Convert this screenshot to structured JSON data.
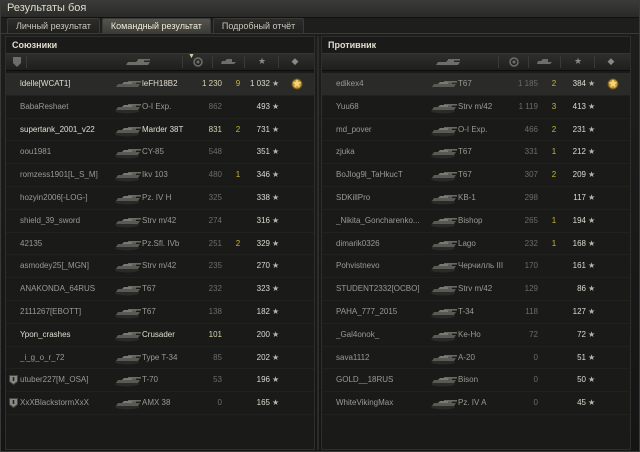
{
  "window": {
    "title": "Результаты боя"
  },
  "tabs": [
    {
      "label": "Личный результат",
      "active": false
    },
    {
      "label": "Командный результат",
      "active": true
    },
    {
      "label": "Подробный отчёт",
      "active": false
    }
  ],
  "allies": {
    "title": "Союзники",
    "rows": [
      {
        "name": "ldelle[WCAT1]",
        "vehicle": "leFH18B2",
        "damage": "1 230",
        "kills": "9",
        "xp": "1 032",
        "highlight": true,
        "medal": true,
        "platoon": false,
        "bright": true
      },
      {
        "name": "BabaReshaet",
        "vehicle": "O-I Exp.",
        "damage": "862",
        "kills": "",
        "xp": "493",
        "highlight": false,
        "medal": false,
        "platoon": false,
        "bright": false
      },
      {
        "name": "supertank_2001_v22",
        "vehicle": "Marder 38T",
        "damage": "831",
        "kills": "2",
        "xp": "731",
        "highlight": false,
        "medal": false,
        "platoon": false,
        "bright": true
      },
      {
        "name": "oou1981",
        "vehicle": "CY-85",
        "damage": "548",
        "kills": "",
        "xp": "351",
        "highlight": false,
        "medal": false,
        "platoon": false,
        "bright": false
      },
      {
        "name": "romzess1901[L_S_M]",
        "vehicle": "Ikv 103",
        "damage": "480",
        "kills": "1",
        "xp": "346",
        "highlight": false,
        "medal": false,
        "platoon": false,
        "bright": false
      },
      {
        "name": "hozyin2006[-LOG-]",
        "vehicle": "Pz. IV H",
        "damage": "325",
        "kills": "",
        "xp": "338",
        "highlight": false,
        "medal": false,
        "platoon": false,
        "bright": false
      },
      {
        "name": "shield_39_sword",
        "vehicle": "Strv m/42",
        "damage": "274",
        "kills": "",
        "xp": "316",
        "highlight": false,
        "medal": false,
        "platoon": false,
        "bright": false
      },
      {
        "name": "42135",
        "vehicle": "Pz.Sfl. IVb",
        "damage": "251",
        "kills": "2",
        "xp": "329",
        "highlight": false,
        "medal": false,
        "platoon": false,
        "bright": false
      },
      {
        "name": "asmodey25[_MGN]",
        "vehicle": "Strv m/42",
        "damage": "235",
        "kills": "",
        "xp": "270",
        "highlight": false,
        "medal": false,
        "platoon": false,
        "bright": false
      },
      {
        "name": "ANAKONDA_64RUS",
        "vehicle": "T67",
        "damage": "232",
        "kills": "",
        "xp": "323",
        "highlight": false,
        "medal": false,
        "platoon": false,
        "bright": false
      },
      {
        "name": "2111267[EBOTT]",
        "vehicle": "T67",
        "damage": "138",
        "kills": "",
        "xp": "182",
        "highlight": false,
        "medal": false,
        "platoon": false,
        "bright": false
      },
      {
        "name": "Ypon_crashes",
        "vehicle": "Crusader",
        "damage": "101",
        "kills": "",
        "xp": "200",
        "highlight": false,
        "medal": false,
        "platoon": false,
        "bright": true,
        "yellow": true
      },
      {
        "name": "_i_g_o_r_72",
        "vehicle": "Type T-34",
        "damage": "85",
        "kills": "",
        "xp": "202",
        "highlight": false,
        "medal": false,
        "platoon": false,
        "bright": false
      },
      {
        "name": "utuber227[M_OSA]",
        "vehicle": "T-70",
        "damage": "53",
        "kills": "",
        "xp": "196",
        "highlight": false,
        "medal": false,
        "platoon": true,
        "bright": false
      },
      {
        "name": "XxXBlackstormXxX",
        "vehicle": "AMX 38",
        "damage": "0",
        "kills": "",
        "xp": "165",
        "highlight": false,
        "medal": false,
        "platoon": true,
        "bright": false
      }
    ]
  },
  "enemies": {
    "title": "Противник",
    "rows": [
      {
        "name": "edikex4",
        "vehicle": "T67",
        "damage": "1 185",
        "kills": "2",
        "xp": "384",
        "highlight": true,
        "medal": true
      },
      {
        "name": "Yuu68",
        "vehicle": "Strv m/42",
        "damage": "1 119",
        "kills": "3",
        "xp": "413"
      },
      {
        "name": "md_pover",
        "vehicle": "O-I Exp.",
        "damage": "466",
        "kills": "2",
        "xp": "231"
      },
      {
        "name": "zjuka",
        "vehicle": "T67",
        "damage": "331",
        "kills": "1",
        "xp": "212"
      },
      {
        "name": "BoJlog9l_TaHkucT",
        "vehicle": "T67",
        "damage": "307",
        "kills": "2",
        "xp": "209"
      },
      {
        "name": "SDKillPro",
        "vehicle": "KB-1",
        "damage": "298",
        "kills": "",
        "xp": "117"
      },
      {
        "name": "_Nikita_Goncharenko...",
        "vehicle": "Bishop",
        "damage": "265",
        "kills": "1",
        "xp": "194"
      },
      {
        "name": "dimarik0326",
        "vehicle": "Lago",
        "damage": "232",
        "kills": "1",
        "xp": "168"
      },
      {
        "name": "Pohvistnevo",
        "vehicle": "Черчилль III",
        "damage": "170",
        "kills": "",
        "xp": "161"
      },
      {
        "name": "STUDENT2332[OCBO]",
        "vehicle": "Strv m/42",
        "damage": "129",
        "kills": "",
        "xp": "86"
      },
      {
        "name": "PAHA_777_2015",
        "vehicle": "T-34",
        "damage": "118",
        "kills": "",
        "xp": "127"
      },
      {
        "name": "_Gal4onok_",
        "vehicle": "Ke-Ho",
        "damage": "72",
        "kills": "",
        "xp": "72"
      },
      {
        "name": "sava1112",
        "vehicle": "A-20",
        "damage": "0",
        "kills": "",
        "xp": "51"
      },
      {
        "name": "GOLD__18RUS",
        "vehicle": "Bison",
        "damage": "0",
        "kills": "",
        "xp": "50"
      },
      {
        "name": "WhiteVikingMax",
        "vehicle": "Pz. IV A",
        "damage": "0",
        "kills": "",
        "xp": "45"
      }
    ]
  },
  "colors": {
    "xp": "#dcdad0",
    "kills": "#c7b63c",
    "muted": "#6c6c66",
    "bright": "#e0ddce"
  },
  "icons": {
    "star": "★",
    "platoon": "platoon-icon",
    "medal": "medal-icon",
    "tank": "tank-icon"
  }
}
